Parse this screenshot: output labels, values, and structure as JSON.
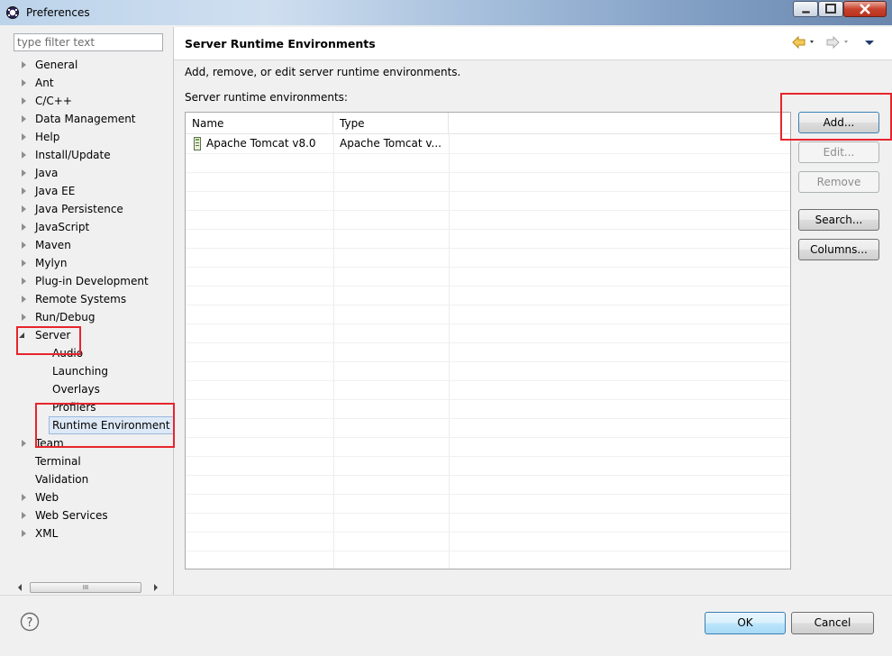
{
  "window": {
    "title": "Preferences"
  },
  "filter": {
    "placeholder": "type filter text"
  },
  "tree": {
    "items": [
      {
        "label": "General",
        "expandable": true
      },
      {
        "label": "Ant",
        "expandable": true
      },
      {
        "label": "C/C++",
        "expandable": true
      },
      {
        "label": "Data Management",
        "expandable": true
      },
      {
        "label": "Help",
        "expandable": true
      },
      {
        "label": "Install/Update",
        "expandable": true
      },
      {
        "label": "Java",
        "expandable": true
      },
      {
        "label": "Java EE",
        "expandable": true
      },
      {
        "label": "Java Persistence",
        "expandable": true
      },
      {
        "label": "JavaScript",
        "expandable": true
      },
      {
        "label": "Maven",
        "expandable": true
      },
      {
        "label": "Mylyn",
        "expandable": true
      },
      {
        "label": "Plug-in Development",
        "expandable": true
      },
      {
        "label": "Remote Systems",
        "expandable": true
      },
      {
        "label": "Run/Debug",
        "expandable": true
      },
      {
        "label": "Server",
        "expandable": true,
        "expanded": true
      },
      {
        "label": "Audio",
        "child": true
      },
      {
        "label": "Launching",
        "child": true
      },
      {
        "label": "Overlays",
        "child": true
      },
      {
        "label": "Profilers",
        "child": true
      },
      {
        "label": "Runtime Environment",
        "child": true,
        "selected": true
      },
      {
        "label": "Team",
        "expandable": true
      },
      {
        "label": "Terminal",
        "expandable": false
      },
      {
        "label": "Validation",
        "expandable": false
      },
      {
        "label": "Web",
        "expandable": true
      },
      {
        "label": "Web Services",
        "expandable": true
      },
      {
        "label": "XML",
        "expandable": true
      }
    ],
    "scroll_grip": "III"
  },
  "page": {
    "title": "Server Runtime Environments",
    "description": "Add, remove, or edit server runtime environments.",
    "list_label": "Server runtime environments:"
  },
  "table": {
    "columns": [
      "Name",
      "Type"
    ],
    "rows": [
      {
        "name": "Apache Tomcat v8.0",
        "type": "Apache Tomcat v...",
        "checked": false
      }
    ]
  },
  "buttons": {
    "add": "Add...",
    "edit": "Edit...",
    "remove": "Remove",
    "search": "Search...",
    "columns": "Columns..."
  },
  "footer": {
    "ok": "OK",
    "cancel": "Cancel"
  },
  "colors": {
    "annotation": "#e8242c",
    "selection": "#dde9f6",
    "nav_arrow": "#e0a020"
  }
}
